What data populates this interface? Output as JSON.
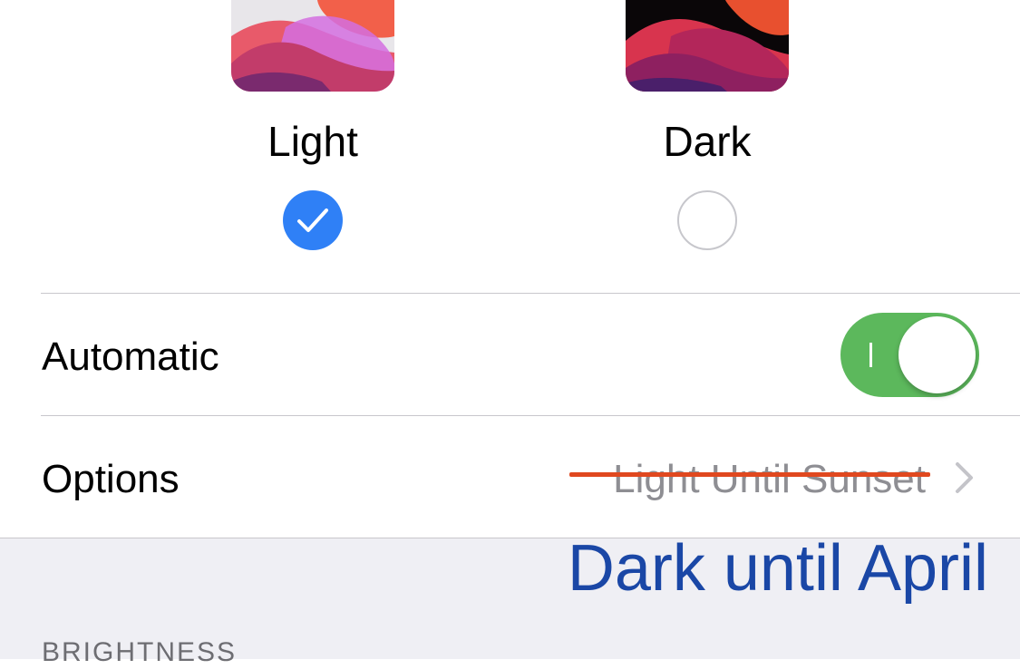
{
  "appearance": {
    "light": {
      "label": "Light",
      "selected": true
    },
    "dark": {
      "label": "Dark",
      "selected": false
    }
  },
  "automatic": {
    "label": "Automatic",
    "toggle_on": true
  },
  "options": {
    "label": "Options",
    "value": "Light Until Sunset",
    "value_struck_through": true
  },
  "annotation": {
    "text": "Dark until April",
    "color": "#1a47a6"
  },
  "section_header": "BRIGHTNESS",
  "icons": {
    "check": "checkmark-icon",
    "chevron": "chevron-right-icon"
  },
  "colors": {
    "accent": "#2f80f6",
    "toggle_on": "#5cb85c",
    "strike": "#e0481f",
    "secondary_text": "#8e8e93",
    "grouped_background": "#efeff4"
  }
}
